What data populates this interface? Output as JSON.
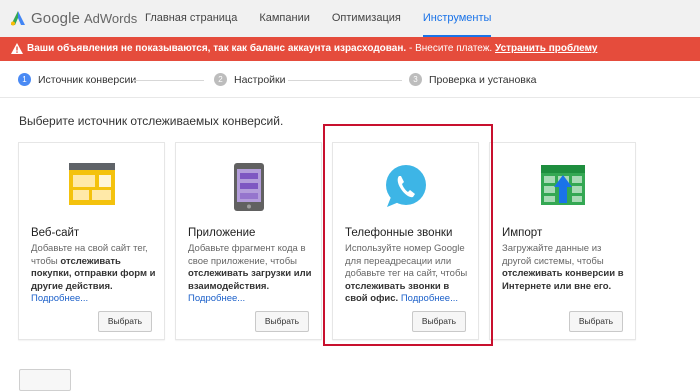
{
  "brand": {
    "google": "Google",
    "adwords": "AdWords"
  },
  "nav": {
    "items": [
      {
        "label": "Главная страница"
      },
      {
        "label": "Кампании"
      },
      {
        "label": "Оптимизация"
      },
      {
        "label": "Инструменты"
      }
    ],
    "active": "Инструменты"
  },
  "alert": {
    "text": "Ваши объявления не показываются, так как баланс аккаунта израсходован.",
    "separator": " - Внесите платеж. ",
    "link": "Устранить проблему",
    "color": "#e54c3c"
  },
  "steps": [
    {
      "num": "1",
      "label": "Источник конверсии"
    },
    {
      "num": "2",
      "label": "Настройки"
    },
    {
      "num": "3",
      "label": "Проверка и установка"
    }
  ],
  "instruction": "Выберите источник отслеживаемых конверсий.",
  "cards": [
    {
      "icon": "website-icon",
      "title": "Веб-сайт",
      "desc_pre": "Добавьте на свой сайт тег, чтобы ",
      "desc_bold": "отслеживать покупки, отправки форм и другие действия.",
      "more": "Подробнее...",
      "button": "Выбрать"
    },
    {
      "icon": "mobile-app-icon",
      "title": "Приложение",
      "desc_pre": "Добавьте фрагмент кода в свое приложение, чтобы ",
      "desc_bold": "отслеживать загрузки или взаимодействия.",
      "more": "Подробнее...",
      "button": "Выбрать"
    },
    {
      "icon": "phone-call-icon",
      "title": "Телефонные звонки",
      "desc_pre": "Используйте номер Google для переадресации или добавьте тег на сайт, чтобы ",
      "desc_bold": "отслеживать звонки в свой офис.",
      "more": "Подробнее...",
      "button": "Выбрать"
    },
    {
      "icon": "import-icon",
      "title": "Импорт",
      "desc_pre": "Загружайте данные из другой системы, чтобы ",
      "desc_bold": "отслеживать конверсии в Интернете или вне его.",
      "more": "Подробнее...",
      "button": "Выбрать"
    }
  ],
  "colors": {
    "accent": "#1a73e8",
    "highlight": "#c8102e"
  }
}
